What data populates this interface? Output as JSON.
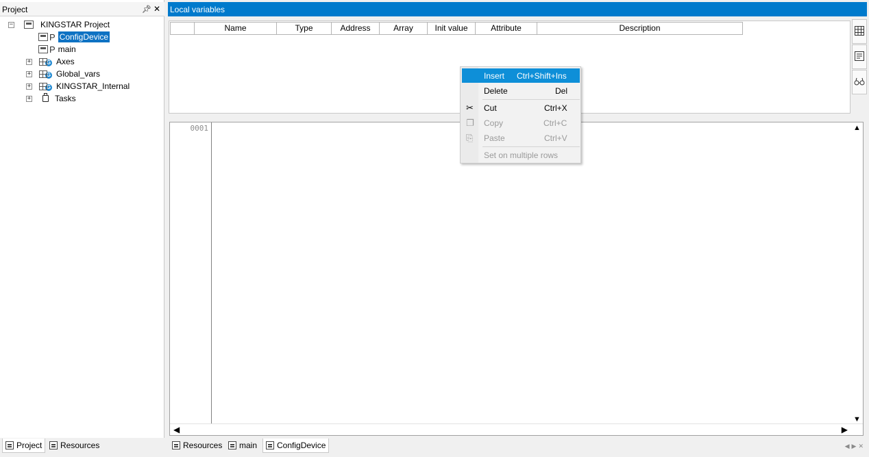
{
  "project_pane": {
    "title": "Project",
    "pin_icon": "pin-icon",
    "close_icon": "close-icon",
    "tree": [
      {
        "label": "KINGSTAR Project",
        "expander": "⊟",
        "icon": "project-icon"
      },
      {
        "label": "ConfigDevice",
        "icon": "program-icon",
        "selected": true
      },
      {
        "label": "main",
        "icon": "program-icon"
      },
      {
        "label": "Axes",
        "expander": "⊞",
        "icon": "global-vars-icon"
      },
      {
        "label": "Global_vars",
        "expander": "⊞",
        "icon": "global-vars-icon"
      },
      {
        "label": "KINGSTAR_Internal",
        "expander": "⊞",
        "icon": "global-vars-icon"
      },
      {
        "label": "Tasks",
        "expander": "⊞",
        "icon": "tasks-icon"
      }
    ],
    "program_letter": "P",
    "g_letter": "G",
    "tabs": [
      "Project",
      "Resources"
    ]
  },
  "local_variables": {
    "title": "Local variables",
    "columns": [
      "",
      "Name",
      "Type",
      "Address",
      "Array",
      "Init value",
      "Attribute",
      "Description"
    ]
  },
  "editor": {
    "line_numbers": [
      "0001"
    ],
    "tabs": [
      "Resources",
      "main",
      "ConfigDevice"
    ]
  },
  "context_menu": {
    "items": [
      {
        "label": "Insert",
        "shortcut": "Ctrl+Shift+Ins"
      },
      {
        "label": "Delete",
        "shortcut": "Del"
      },
      {
        "label": "Cut",
        "shortcut": "Ctrl+X"
      },
      {
        "label": "Copy",
        "shortcut": "Ctrl+C"
      },
      {
        "label": "Paste",
        "shortcut": "Ctrl+V"
      },
      {
        "label": "Set on multiple rows",
        "shortcut": ""
      }
    ]
  },
  "colors": {
    "accent": "#007acc",
    "selection": "#0e72c3",
    "menu_highlight": "#0e8fd8"
  }
}
